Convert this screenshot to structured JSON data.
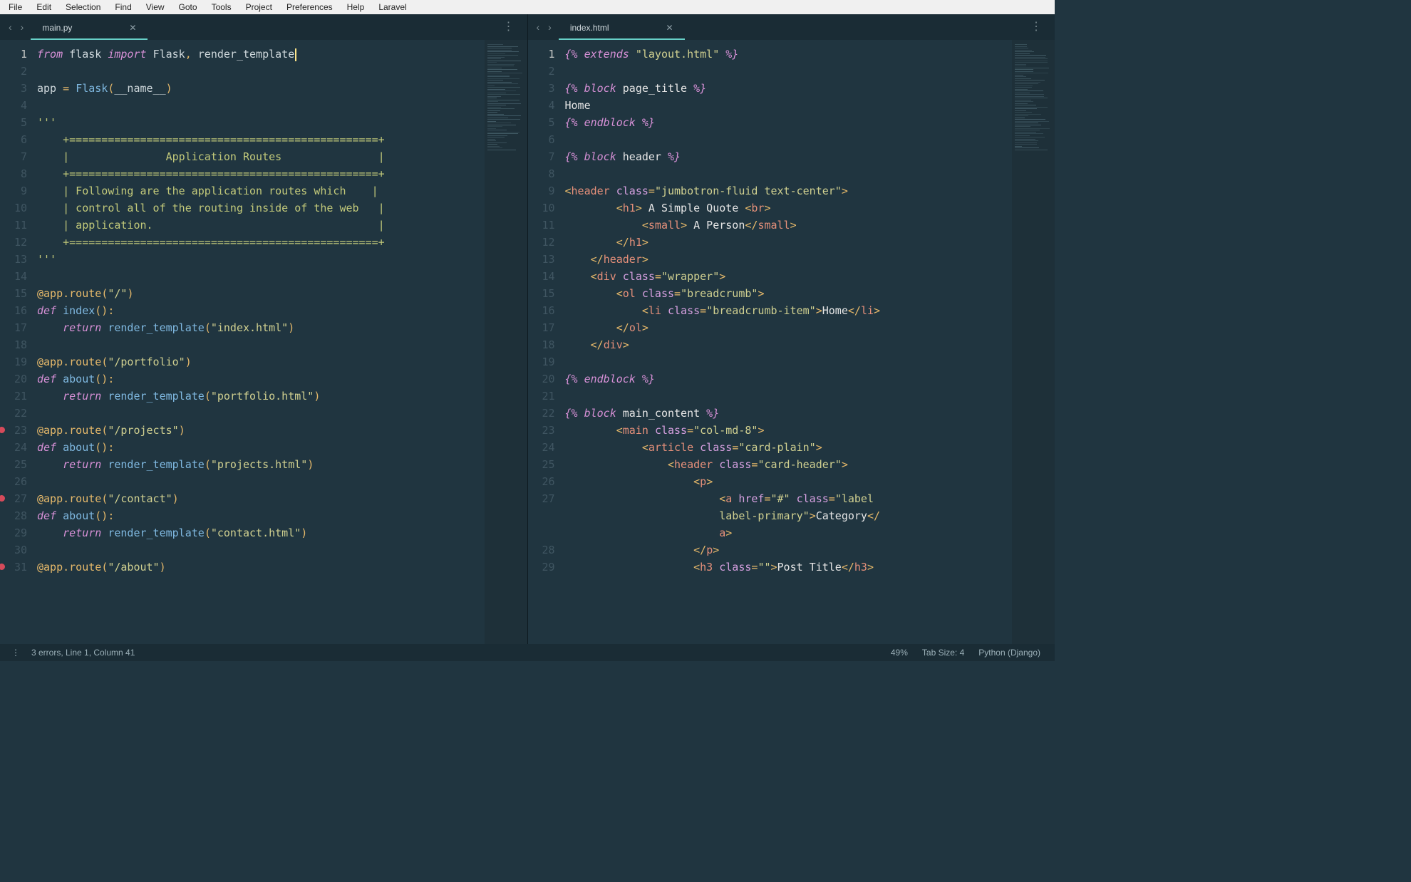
{
  "menu": {
    "items": [
      "File",
      "Edit",
      "Selection",
      "Find",
      "View",
      "Goto",
      "Tools",
      "Project",
      "Preferences",
      "Help",
      "Laravel"
    ]
  },
  "panes": [
    {
      "tab": {
        "name": "main.py"
      },
      "lines": [
        {
          "n": 1,
          "current": true,
          "html": "<span class='kw'>from</span> <span class='id'>flask</span> <span class='kw'>import</span> <span class='id'>Flask</span><span class='op'>,</span> <span class='id'>render_template</span><span class='cursor'></span>"
        },
        {
          "n": 2,
          "html": ""
        },
        {
          "n": 3,
          "html": "<span class='id'>app</span> <span class='op'>=</span> <span class='fn'>Flask</span><span class='op'>(</span><span class='id'>__name__</span><span class='op'>)</span>"
        },
        {
          "n": 4,
          "html": ""
        },
        {
          "n": 5,
          "html": "<span class='cmt'>'''</span>"
        },
        {
          "n": 6,
          "html": "<span class='cmt'>    +================================================+</span>"
        },
        {
          "n": 7,
          "html": "<span class='cmt'>    |               Application Routes               |</span>"
        },
        {
          "n": 8,
          "html": "<span class='cmt'>    +================================================+</span>"
        },
        {
          "n": 9,
          "html": "<span class='cmt'>    | Following are the application routes which    |</span>"
        },
        {
          "n": 10,
          "html": "<span class='cmt'>    | control all of the routing inside of the web   |</span>"
        },
        {
          "n": 11,
          "html": "<span class='cmt'>    | application.                                   |</span>"
        },
        {
          "n": 12,
          "html": "<span class='cmt'>    +================================================+</span>"
        },
        {
          "n": 13,
          "html": "<span class='cmt'>'''</span>"
        },
        {
          "n": 14,
          "html": ""
        },
        {
          "n": 15,
          "html": "<span class='dec'>@app.route</span><span class='op'>(</span><span class='str'>\"/\"</span><span class='op'>)</span>"
        },
        {
          "n": 16,
          "html": "<span class='kw2'>def</span> <span class='fn'>index</span><span class='op'>():</span>"
        },
        {
          "n": 17,
          "html": "    <span class='kw2'>return</span> <span class='fn'>render_template</span><span class='op'>(</span><span class='str'>\"index.html\"</span><span class='op'>)</span>"
        },
        {
          "n": 18,
          "html": ""
        },
        {
          "n": 19,
          "html": "<span class='dec'>@app.route</span><span class='op'>(</span><span class='str'>\"/portfolio\"</span><span class='op'>)</span>"
        },
        {
          "n": 20,
          "html": "<span class='kw2'>def</span> <span class='fn'>about</span><span class='op'>():</span>"
        },
        {
          "n": 21,
          "html": "    <span class='kw2'>return</span> <span class='fn'>render_template</span><span class='op'>(</span><span class='str'>\"portfolio.html\"</span><span class='op'>)</span>"
        },
        {
          "n": 22,
          "html": ""
        },
        {
          "n": 23,
          "bp": true,
          "html": "<span class='dec'>@app.route</span><span class='op'>(</span><span class='str'>\"/projects\"</span><span class='op'>)</span>"
        },
        {
          "n": 24,
          "html": "<span class='kw2'>def</span> <span class='fn'>about</span><span class='op'>():</span>"
        },
        {
          "n": 25,
          "html": "    <span class='kw2'>return</span> <span class='fn'>render_template</span><span class='op'>(</span><span class='str'>\"projects.html\"</span><span class='op'>)</span>"
        },
        {
          "n": 26,
          "html": ""
        },
        {
          "n": 27,
          "bp": true,
          "html": "<span class='dec'>@app.route</span><span class='op'>(</span><span class='str'>\"/contact\"</span><span class='op'>)</span>"
        },
        {
          "n": 28,
          "html": "<span class='kw2'>def</span> <span class='fn'>about</span><span class='op'>():</span>"
        },
        {
          "n": 29,
          "html": "    <span class='kw2'>return</span> <span class='fn'>render_template</span><span class='op'>(</span><span class='str'>\"contact.html\"</span><span class='op'>)</span>"
        },
        {
          "n": 30,
          "html": ""
        },
        {
          "n": 31,
          "bp": true,
          "html": "<span class='dec'>@app.route</span><span class='op'>(</span><span class='str'>\"/about\"</span><span class='op'>)</span>"
        }
      ]
    },
    {
      "tab": {
        "name": "index.html"
      },
      "lines": [
        {
          "n": 1,
          "current": true,
          "html": "<span class='django'>{% extends </span><span class='str'>\"layout.html\"</span><span class='django'> %}</span>"
        },
        {
          "n": 2,
          "html": ""
        },
        {
          "n": 3,
          "html": "<span class='django'>{% block </span><span class='djvar'>page_title</span><span class='django'> %}</span>"
        },
        {
          "n": 4,
          "html": "<span class='txt'>Home</span>"
        },
        {
          "n": 5,
          "html": "<span class='django'>{% endblock %}</span>"
        },
        {
          "n": 6,
          "html": ""
        },
        {
          "n": 7,
          "html": "<span class='django'>{% block </span><span class='djvar'>header</span><span class='django'> %}</span>"
        },
        {
          "n": 8,
          "html": ""
        },
        {
          "n": 9,
          "html": "<span class='op'>&lt;</span><span class='tag'>header</span> <span class='attr'>class</span><span class='op'>=</span><span class='str'>\"jumbotron-fluid text-center\"</span><span class='op'>&gt;</span>"
        },
        {
          "n": 10,
          "html": "        <span class='op'>&lt;</span><span class='tag'>h1</span><span class='op'>&gt;</span><span class='txt'> A Simple Quote </span><span class='op'>&lt;</span><span class='tag'>br</span><span class='op'>&gt;</span>"
        },
        {
          "n": 11,
          "html": "            <span class='op'>&lt;</span><span class='tag'>small</span><span class='op'>&gt;</span><span class='txt'> A Person</span><span class='op'>&lt;/</span><span class='tag'>small</span><span class='op'>&gt;</span>"
        },
        {
          "n": 12,
          "html": "        <span class='op'>&lt;/</span><span class='tag'>h1</span><span class='op'>&gt;</span>"
        },
        {
          "n": 13,
          "html": "    <span class='op'>&lt;/</span><span class='tag'>header</span><span class='op'>&gt;</span>"
        },
        {
          "n": 14,
          "html": "    <span class='op'>&lt;</span><span class='tag'>div</span> <span class='attr'>class</span><span class='op'>=</span><span class='str'>\"wrapper\"</span><span class='op'>&gt;</span>"
        },
        {
          "n": 15,
          "html": "        <span class='op'>&lt;</span><span class='tag'>ol</span> <span class='attr'>class</span><span class='op'>=</span><span class='str'>\"breadcrumb\"</span><span class='op'>&gt;</span>"
        },
        {
          "n": 16,
          "html": "            <span class='op'>&lt;</span><span class='tag'>li</span> <span class='attr'>class</span><span class='op'>=</span><span class='str'>\"breadcrumb-item\"</span><span class='op'>&gt;</span><span class='txt'>Home</span><span class='op'>&lt;/</span><span class='tag'>li</span><span class='op'>&gt;</span>"
        },
        {
          "n": 17,
          "html": "        <span class='op'>&lt;/</span><span class='tag'>ol</span><span class='op'>&gt;</span>"
        },
        {
          "n": 18,
          "html": "    <span class='op'>&lt;/</span><span class='tag'>div</span><span class='op'>&gt;</span>"
        },
        {
          "n": 19,
          "html": ""
        },
        {
          "n": 20,
          "html": "<span class='django'>{% endblock %}</span>"
        },
        {
          "n": 21,
          "html": ""
        },
        {
          "n": 22,
          "html": "<span class='django'>{% block </span><span class='djvar'>main_content</span><span class='django'> %}</span>"
        },
        {
          "n": 23,
          "html": "        <span class='op'>&lt;</span><span class='tag'>main</span> <span class='attr'>class</span><span class='op'>=</span><span class='str'>\"col-md-8\"</span><span class='op'>&gt;</span>"
        },
        {
          "n": 24,
          "html": "            <span class='op'>&lt;</span><span class='tag'>article</span> <span class='attr'>class</span><span class='op'>=</span><span class='str'>\"card-plain\"</span><span class='op'>&gt;</span>"
        },
        {
          "n": 25,
          "html": "                <span class='op'>&lt;</span><span class='tag'>header</span> <span class='attr'>class</span><span class='op'>=</span><span class='str'>\"card-header\"</span><span class='op'>&gt;</span>"
        },
        {
          "n": 26,
          "html": "                    <span class='op'>&lt;</span><span class='tag'>p</span><span class='op'>&gt;</span>"
        },
        {
          "n": 27,
          "html": "                        <span class='op'>&lt;</span><span class='tag'>a</span> <span class='attr'>href</span><span class='op'>=</span><span class='str'>\"#\"</span> <span class='attr'>class</span><span class='op'>=</span><span class='str'>\"label </span>"
        },
        {
          "n": "",
          "html": "                        <span class='str'>label-primary\"</span><span class='op'>&gt;</span><span class='txt'>Category</span><span class='op'>&lt;/</span>"
        },
        {
          "n": "",
          "html": "                        <span class='tag'>a</span><span class='op'>&gt;</span>"
        },
        {
          "n": 28,
          "html": "                    <span class='op'>&lt;/</span><span class='tag'>p</span><span class='op'>&gt;</span>"
        },
        {
          "n": 29,
          "html": "                    <span class='op'>&lt;</span><span class='tag'>h3</span> <span class='attr'>class</span><span class='op'>=</span><span class='str'>\"\"</span><span class='op'>&gt;</span><span class='txt'>Post Title</span><span class='op'>&lt;/</span><span class='tag'>h3</span><span class='op'>&gt;</span>"
        }
      ]
    }
  ],
  "status": {
    "left": "3 errors, Line 1, Column 41",
    "zoom": "49%",
    "tabsize": "Tab Size: 4",
    "syntax": "Python (Django)"
  }
}
